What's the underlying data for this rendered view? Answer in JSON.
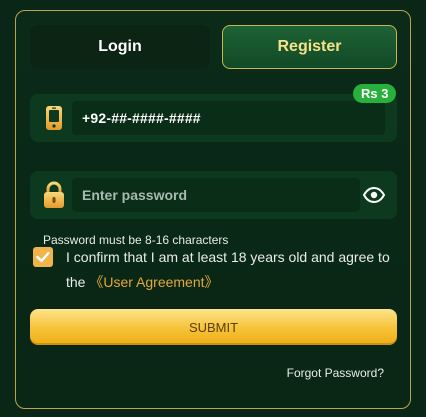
{
  "tabs": {
    "login_label": "Login",
    "register_label": "Register",
    "active": "register"
  },
  "phone": {
    "value": "+92-##-####-####",
    "badge": "Rs 3",
    "icon": "phone-icon"
  },
  "password": {
    "placeholder": "Enter password",
    "icon": "lock-icon",
    "toggle_icon": "eye-icon",
    "hint": "Password must be 8-16 characters"
  },
  "agreement": {
    "checked": true,
    "text": "I confirm that I am at least 18 years old and agree to the ",
    "link": "《User Agreement》"
  },
  "submit_label": "SUBMIT",
  "forgot_label": "Forgot Password?",
  "colors": {
    "accent_gold": "#f6c237",
    "badge_green": "#27b13c",
    "panel_border": "#b9a54c",
    "background": "#0a2616"
  }
}
